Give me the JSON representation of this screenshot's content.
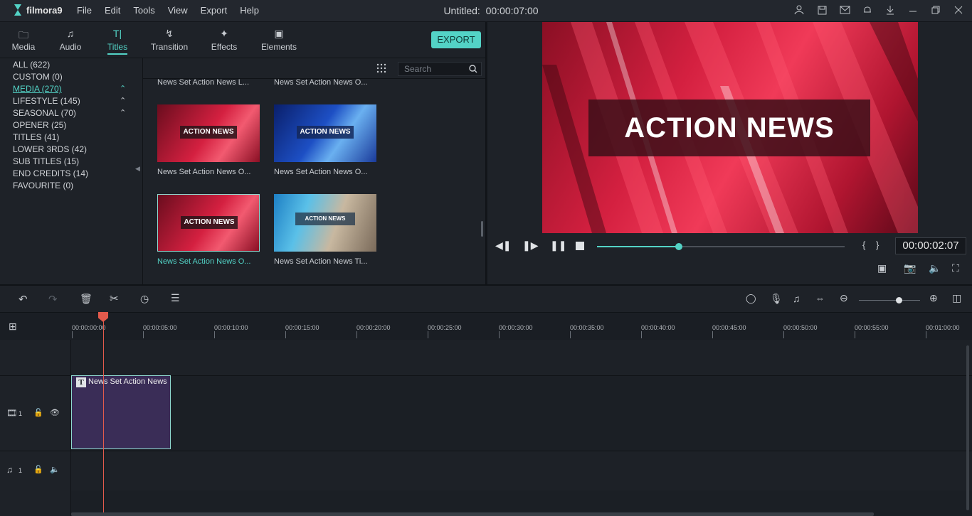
{
  "app": {
    "name": "filmora9",
    "title": "Untitled:",
    "time": "00:00:07:00"
  },
  "menu": [
    "File",
    "Edit",
    "Tools",
    "View",
    "Export",
    "Help"
  ],
  "titlebar_icons": [
    "user-icon",
    "save-icon",
    "mail-icon",
    "notification-icon",
    "download-icon",
    "minimize-icon",
    "restore-icon",
    "close-icon"
  ],
  "tabs": [
    {
      "label": "Media",
      "icon": "folder-icon"
    },
    {
      "label": "Audio",
      "icon": "music-note-icon"
    },
    {
      "label": "Titles",
      "icon": "text-icon",
      "active": true
    },
    {
      "label": "Transition",
      "icon": "transition-icon"
    },
    {
      "label": "Effects",
      "icon": "effects-icon"
    },
    {
      "label": "Elements",
      "icon": "image-icon"
    }
  ],
  "export_label": "EXPORT",
  "categories": [
    {
      "label": "ALL (622)"
    },
    {
      "label": "CUSTOM (0)"
    },
    {
      "label": "MEDIA (270)",
      "active": true,
      "expandable": true
    },
    {
      "label": "LIFESTYLE (145)",
      "expandable": true
    },
    {
      "label": "SEASONAL (70)",
      "expandable": true
    },
    {
      "label": "OPENER (25)"
    },
    {
      "label": "TITLES (41)"
    },
    {
      "label": "LOWER 3RDS (42)"
    },
    {
      "label": "SUB TITLES (15)"
    },
    {
      "label": "END CREDITS (14)"
    },
    {
      "label": "FAVOURITE (0)"
    }
  ],
  "search": {
    "placeholder": "Search"
  },
  "thumbnails": [
    {
      "name": "News Set Action News L...",
      "text": ""
    },
    {
      "name": "News Set Action News O...",
      "text": ""
    },
    {
      "name": "News Set Action News O...",
      "text": "ACTION NEWS",
      "color": "#c8203a"
    },
    {
      "name": "News Set Action News O...",
      "text": "ACTION NEWS",
      "color": "#1d4fc4"
    },
    {
      "name": "News Set Action News O...",
      "text": "ACTION NEWS",
      "color": "#c8203a",
      "selected": true
    },
    {
      "name": "News Set Action News Ti...",
      "text": "ACTION NEWS",
      "color": "#3a8fb0"
    }
  ],
  "preview": {
    "title": "ACTION NEWS",
    "timecode": "00:00:02:07",
    "progress": 0.33
  },
  "timeline": {
    "ticks": [
      "00:00:00:00",
      "00:00:05:00",
      "00:00:10:00",
      "00:00:15:00",
      "00:00:20:00",
      "00:00:25:00",
      "00:00:30:00",
      "00:00:35:00",
      "00:00:40:00",
      "00:00:45:00",
      "00:00:50:00",
      "00:00:55:00",
      "00:01:00:00"
    ],
    "video_track": "1",
    "audio_track": "1",
    "clip_label": "News Set Action News O",
    "zoom": 0.65
  }
}
